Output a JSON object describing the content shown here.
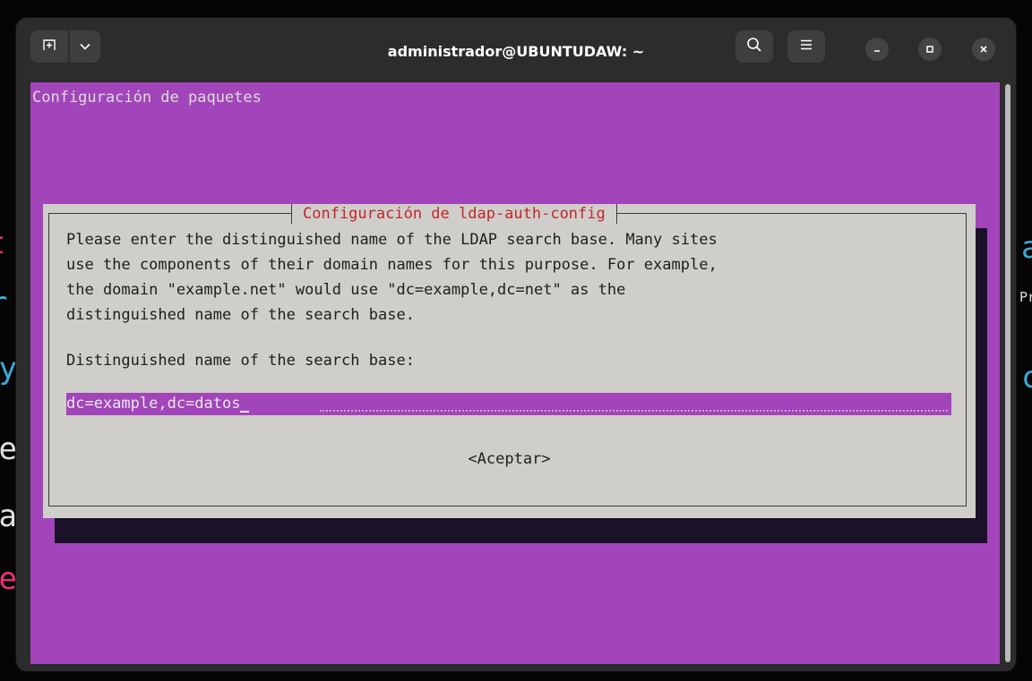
{
  "window": {
    "title": "administrador@UBUNTUDAW: ~"
  },
  "titlebar": {
    "new_tab_icon": "new-tab-icon",
    "dropdown_icon": "chevron-down-icon",
    "search_icon": "search-icon",
    "menu_icon": "hamburger-menu-icon",
    "minimize_icon": "minimize-icon",
    "maximize_icon": "maximize-icon",
    "close_icon": "close-icon"
  },
  "terminal": {
    "header": "Configuración de paquetes",
    "background_color": "#a245ba"
  },
  "dialog": {
    "title": "Configuración de ldap-auth-config",
    "description": "Please enter the distinguished name of the LDAP search base. Many sites\nuse the components of their domain names for this purpose. For example,\nthe domain \"example.net\" would use \"dc=example,dc=net\" as the\ndistinguished name of the search base.",
    "prompt": "Distinguished name of the search base:",
    "input_value": "dc=example,dc=datos",
    "ok_button": "<Aceptar>",
    "title_color": "#c0272d",
    "background_color": "#d0ceca"
  },
  "background_fragments": {
    "left": [
      "t",
      "r",
      "ly",
      "le",
      "la",
      "re"
    ],
    "right": [
      "a",
      "Pr",
      "c"
    ]
  }
}
